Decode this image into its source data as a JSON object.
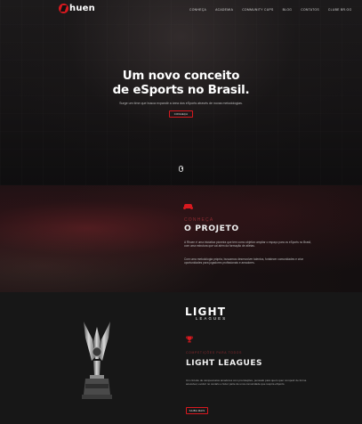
{
  "nav": {
    "logo_text": "huen",
    "items": [
      "Conheça",
      "Academia",
      "Community Cups",
      "Blog",
      "Contatos",
      "Clube BR.GG"
    ]
  },
  "hero": {
    "title_line1": "Um novo conceito",
    "title_line2": "de eSports no Brasil.",
    "subtitle": "Surge um time que busca expandir a área dos eSports através de novas metodologias.",
    "button_label": "Conheça"
  },
  "projeto": {
    "kicker": "Conheça",
    "title": "O Projeto",
    "paragraph1": "A Rhuen é uma iniciativa pioneira que tem como objetivo ampliar o espaço para os eSports no Brasil, com uma estrutura que vai além da formação de atletas.",
    "paragraph2": "Com uma metodologia própria, buscamos desenvolver talentos, fortalecer comunidades e criar oportunidades para jogadores profissionais e amadores."
  },
  "light_leagues": {
    "logo_light": "LIGHT",
    "logo_leagues": "LEAGUES",
    "kicker": "Competições para todos",
    "title": "Light Leagues",
    "paragraph": "Um circuito de campeonatos amadores com premiações, pensado para quem quer competir de forma acessível, evoluir no cenário e fazer parte de uma comunidade que respira eSports.",
    "button_label": "Saiba mais"
  },
  "colors": {
    "accent": "#d8191f",
    "kicker": "#8b2a30",
    "background": "#111111"
  },
  "icons": [
    "scroll-mouse-icon",
    "gamepad-icon",
    "trophy-icon"
  ]
}
